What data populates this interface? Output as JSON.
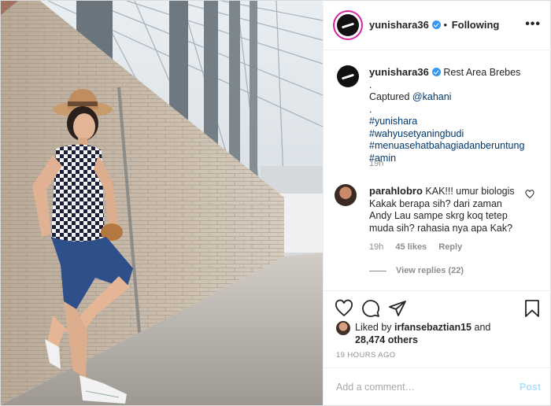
{
  "post": {
    "username": "yunishara36",
    "follow_status": "Following",
    "more_label": "•••",
    "separator": "•"
  },
  "caption": {
    "username": "yunishara36",
    "location": "Rest Area Brebes",
    "dot1": ".",
    "captured_prefix": "Captured",
    "captured_handle": "@kahani",
    "dot2": ".",
    "hashtags": [
      "#yunishara",
      "#wahyusetyaningbudi",
      "#menuasehatbahagiadanberuntung",
      "#amin"
    ],
    "time": "19h"
  },
  "comment": {
    "username": "parahlobro",
    "text": "KAK!!! umur biologis Kakak berapa sih? dari zaman Andy Lau sampe skrg koq tetep muda sih? rahasia nya apa Kak?",
    "time": "19h",
    "likes": "45 likes",
    "reply": "Reply",
    "view_replies": "View replies (22)"
  },
  "actions": {
    "icons": [
      "heart-icon",
      "comment-icon",
      "share-icon",
      "bookmark-icon"
    ]
  },
  "likes": {
    "prefix": "Liked by",
    "user": "irfansebaztian15",
    "and": "and",
    "others": "28,474 others"
  },
  "date": "19 HOURS AGO",
  "add_comment": {
    "placeholder": "Add a comment…",
    "post_label": "Post"
  },
  "colors": {
    "accent_blue": "#3897f0",
    "post_disabled": "#b2dffc",
    "meta_gray": "#8e8e8e",
    "link": "#00376b"
  }
}
